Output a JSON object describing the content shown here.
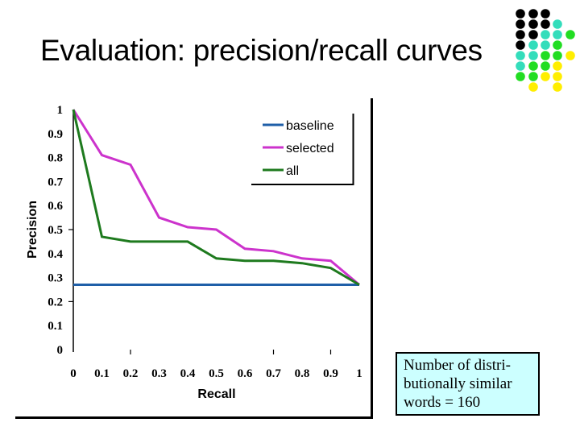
{
  "slide": {
    "title": "Evaluation: precision/recall curves",
    "note_lines": [
      "Number of  distri-",
      "butionally similar",
      "words = 160"
    ],
    "decoration": {
      "name": "dot-grid",
      "colors": {
        "K": "#000000",
        "T": "#33ddbb",
        "G": "#22dd22",
        "Y": "#ffee00"
      },
      "rows": [
        "KKK..",
        "KKKT.",
        "KKTTG",
        "KTTG.",
        "TTGGY",
        "TGGY.",
        "GGYY.",
        ".Y.Y."
      ]
    }
  },
  "chart_data": {
    "type": "line",
    "title": "",
    "xlabel": "Recall",
    "ylabel": "Precision",
    "xlim": [
      0,
      1
    ],
    "ylim": [
      0,
      1
    ],
    "x": [
      0,
      0.1,
      0.2,
      0.3,
      0.4,
      0.5,
      0.6,
      0.7,
      0.8,
      0.9,
      1
    ],
    "x_tick_labels": [
      "0",
      "0.1",
      "0.2",
      "0.3",
      "0.4",
      "0.5",
      "0.6",
      "0.7",
      "0.8",
      "0.9",
      "1"
    ],
    "y_tick_labels": [
      "0",
      "0.1",
      "0.2",
      "0.3",
      "0.4",
      "0.5",
      "0.6",
      "0.7",
      "0.8",
      "0.9",
      "1"
    ],
    "y_ticks": [
      0,
      0.1,
      0.2,
      0.3,
      0.4,
      0.5,
      0.6,
      0.7,
      0.8,
      0.9,
      1
    ],
    "grid": false,
    "legend_position": "top-right",
    "series": [
      {
        "name": "baseline",
        "color": "#1f5fa8",
        "values": [
          0.27,
          0.27,
          0.27,
          0.27,
          0.27,
          0.27,
          0.27,
          0.27,
          0.27,
          0.27,
          0.27
        ]
      },
      {
        "name": "selected",
        "color": "#cc33cc",
        "values": [
          1.0,
          0.81,
          0.77,
          0.55,
          0.51,
          0.5,
          0.42,
          0.41,
          0.38,
          0.37,
          0.27
        ]
      },
      {
        "name": "all",
        "color": "#1e7a1e",
        "values": [
          1.0,
          0.47,
          0.45,
          0.45,
          0.45,
          0.38,
          0.37,
          0.37,
          0.36,
          0.34,
          0.27
        ]
      }
    ]
  }
}
